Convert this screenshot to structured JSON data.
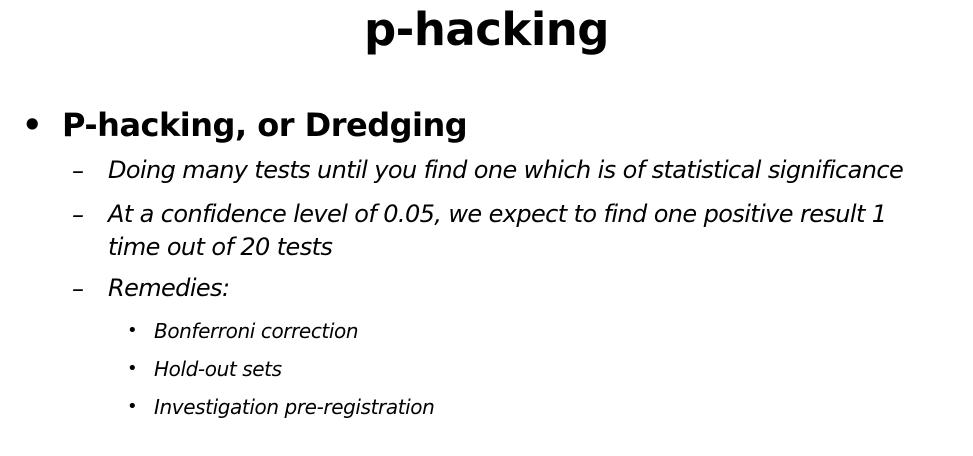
{
  "slide": {
    "title": "p-hacking",
    "bullets": [
      {
        "marker": "•",
        "text": "P-hacking, or Dredging",
        "sub_bullets": [
          {
            "marker": "–",
            "text": "Doing many tests until you find one which is of statistical significance"
          },
          {
            "marker": "–",
            "text": "At a confidence level of 0.05, we expect to find one positive result 1 time out of 20 tests"
          },
          {
            "marker": "–",
            "text": "Remedies:",
            "sub_bullets": [
              {
                "marker": "•",
                "text": "Bonferroni correction"
              },
              {
                "marker": "•",
                "text": "Hold-out sets"
              },
              {
                "marker": "•",
                "text": "Investigation pre-registration"
              }
            ]
          }
        ]
      }
    ]
  }
}
